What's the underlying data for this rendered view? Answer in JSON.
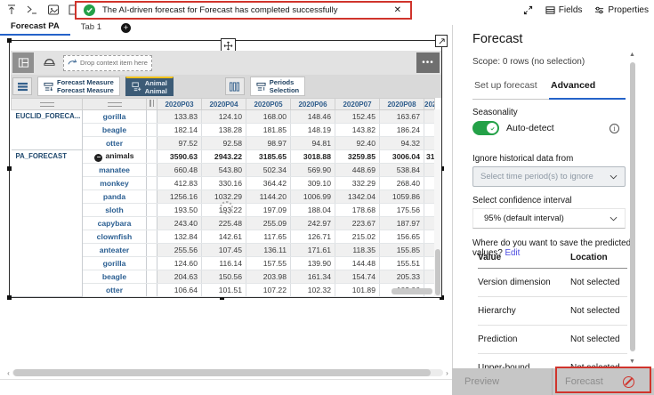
{
  "topbar": {
    "fields_label": "Fields",
    "properties_label": "Properties"
  },
  "notification": {
    "message": "The AI-driven forecast for Forecast has completed successfully",
    "close_glyph": "✕"
  },
  "tabs": {
    "items": [
      {
        "label": "Forecast PA",
        "active": true
      },
      {
        "label": "Tab 1",
        "active": false
      }
    ],
    "add_glyph": "+"
  },
  "widget": {
    "drop_zone_label": "Drop context item here",
    "more_label": "•••",
    "chips": [
      {
        "line1": "Forecast Measure",
        "line2": "Forecast Measure",
        "selected": false
      },
      {
        "line1": "Animal",
        "line2": "Animal",
        "selected": true
      },
      {
        "line1": "Periods",
        "line2": "Selection",
        "selected": false
      }
    ],
    "grid": {
      "columns": [
        "2020P03",
        "2020P04",
        "2020P05",
        "2020P06",
        "2020P07",
        "2020P08"
      ],
      "partial_column": "2020",
      "collapse_glyph": "−",
      "rows": [
        {
          "group": "EUCLID_FORECA...",
          "span": 3,
          "member": "gorilla",
          "values": [
            "133.83",
            "124.10",
            "168.00",
            "148.46",
            "152.45",
            "163.67"
          ],
          "partial": ""
        },
        {
          "member": "beagle",
          "values": [
            "182.14",
            "138.28",
            "181.85",
            "148.19",
            "143.82",
            "186.24"
          ],
          "partial": ""
        },
        {
          "member": "otter",
          "values": [
            "97.52",
            "92.58",
            "98.97",
            "94.81",
            "92.40",
            "94.32"
          ],
          "partial": ""
        },
        {
          "group": "PA_FORECAST",
          "span": 11,
          "member": "animals",
          "aggregate": true,
          "values": [
            "3590.63",
            "2943.22",
            "3185.65",
            "3018.88",
            "3259.85",
            "3006.04"
          ],
          "partial": "31"
        },
        {
          "member": "manatee",
          "values": [
            "660.48",
            "543.80",
            "502.34",
            "569.90",
            "448.69",
            "538.84"
          ],
          "partial": ""
        },
        {
          "member": "monkey",
          "values": [
            "412.83",
            "330.16",
            "364.42",
            "309.10",
            "332.29",
            "268.40"
          ],
          "partial": ""
        },
        {
          "member": "panda",
          "values": [
            "1256.16",
            "1032.29",
            "1144.20",
            "1006.99",
            "1342.04",
            "1059.86"
          ],
          "partial": ""
        },
        {
          "member": "sloth",
          "values": [
            "193.50",
            "193.22",
            "197.09",
            "188.04",
            "178.68",
            "175.56"
          ],
          "partial": ""
        },
        {
          "member": "capybara",
          "values": [
            "243.40",
            "225.48",
            "255.09",
            "242.97",
            "223.67",
            "187.97"
          ],
          "partial": ""
        },
        {
          "member": "clownfish",
          "values": [
            "132.84",
            "142.61",
            "117.65",
            "126.71",
            "215.02",
            "156.65"
          ],
          "partial": ""
        },
        {
          "member": "anteater",
          "values": [
            "255.56",
            "107.45",
            "136.11",
            "171.61",
            "118.35",
            "155.85"
          ],
          "partial": ""
        },
        {
          "member": "gorilla",
          "values": [
            "124.60",
            "116.14",
            "157.55",
            "139.90",
            "144.48",
            "155.51"
          ],
          "partial": ""
        },
        {
          "member": "beagle",
          "values": [
            "204.63",
            "150.56",
            "203.98",
            "161.34",
            "154.74",
            "205.33"
          ],
          "partial": ""
        },
        {
          "member": "otter",
          "values": [
            "106.64",
            "101.51",
            "107.22",
            "102.32",
            "101.89",
            "102.06"
          ],
          "partial": ""
        }
      ]
    }
  },
  "panel": {
    "title": "Forecast",
    "scope": "Scope: 0 rows (no selection)",
    "tabs": [
      {
        "label": "Set up forecast",
        "active": false
      },
      {
        "label": "Advanced",
        "active": true
      }
    ],
    "seasonality_label": "Seasonality",
    "seasonality_value": "Auto-detect",
    "info_glyph": "i",
    "ignore_label": "Ignore historical data from",
    "ignore_placeholder": "Select time period(s) to ignore",
    "confidence_label": "Select confidence interval",
    "confidence_value": "95% (default interval)",
    "save_question": "Where do you want to save the predicted values?",
    "edit_link": "Edit",
    "table": {
      "headers": [
        "Value",
        "Location"
      ],
      "rows": [
        {
          "value": "Version dimension",
          "location": "Not selected"
        },
        {
          "value": "Hierarchy",
          "location": "Not selected"
        },
        {
          "value": "Prediction",
          "location": "Not selected"
        },
        {
          "value": "Upper-bound",
          "location": "Not selected"
        }
      ]
    }
  },
  "footer": {
    "preview_label": "Preview",
    "forecast_label": "Forecast"
  },
  "colors": {
    "annotation_red": "#d0342c",
    "success_green": "#24a148",
    "tab_active_blue": "#2563c9",
    "chip_selected_bg": "#3c5b76",
    "chip_selected_accent": "#f1c21b"
  }
}
